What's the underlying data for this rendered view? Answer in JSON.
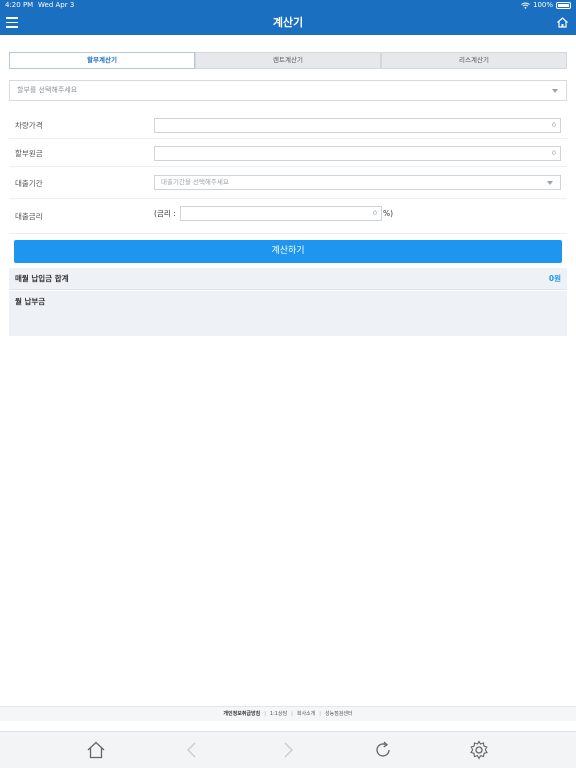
{
  "status_bar": {
    "time": "4:20 PM",
    "date": "Wed Apr 3",
    "battery": "100%"
  },
  "nav": {
    "title": "계산기"
  },
  "tabs": [
    {
      "label": "할부계산기",
      "active": true
    },
    {
      "label": "렌트계산기",
      "active": false
    },
    {
      "label": "리스계산기",
      "active": false
    }
  ],
  "installment_select": {
    "placeholder": "할부를 선택해주세요"
  },
  "form": {
    "vehicle_price": {
      "label": "차량가격",
      "value": "0"
    },
    "principal": {
      "label": "할부원금",
      "value": "0"
    },
    "loan_period": {
      "label": "대출기간",
      "placeholder": "대출기간을 선택해주세요"
    },
    "interest": {
      "label": "대출금리",
      "prefix": "(금리 :",
      "value": "0",
      "suffix": "%)"
    }
  },
  "calc_button": {
    "label": "계산하기"
  },
  "results": {
    "monthly_total_label": "매월 납입금 합계",
    "monthly_total_value": "0원",
    "monthly_payment_label": "월 납부금"
  },
  "footer": {
    "links": [
      "개인정보취급방침",
      "1:1상담",
      "회사소개",
      "성능점검센터"
    ]
  },
  "icons": {
    "menu": "hamburger-menu-icon",
    "home": "home-icon",
    "back": "chevron-left-icon",
    "forward": "chevron-right-icon",
    "refresh": "refresh-icon",
    "settings": "gear-icon"
  },
  "colors": {
    "primary": "#1a6fc0",
    "button": "#1e96f0",
    "result_bg": "#eef2f7"
  }
}
